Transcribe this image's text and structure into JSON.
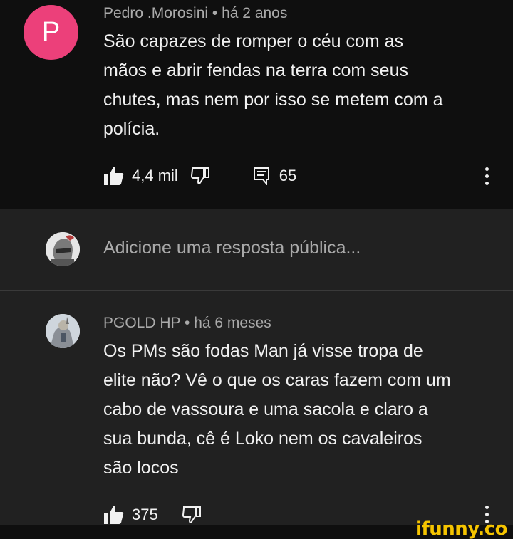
{
  "top_comment": {
    "avatar_letter": "P",
    "avatar_color": "#ec407a",
    "author": "Pedro .Morosini",
    "time": "há 2 anos",
    "lines": [
      "São capazes de romper o céu com as",
      "mãos e abrir fendas na terra com seus",
      "chutes, mas nem por isso se metem com a",
      "polícia."
    ],
    "likes": "4,4 mil",
    "replies": "65"
  },
  "reply_input": {
    "placeholder": "Adicione uma resposta pública..."
  },
  "reply_comment": {
    "author": "PGOLD HP",
    "time": "há 6 meses",
    "lines": [
      "Os PMs são fodas Man já visse tropa de",
      "elite não? Vê o que os caras fazem com um",
      "cabo de vassoura e uma sacola e claro a",
      "sua bunda, cê é Loko nem os cavaleiros",
      "são locos"
    ],
    "likes": "375"
  },
  "meta_separator": "•",
  "watermark": "ifunny.co",
  "icons": {
    "like": "thumbs-up-icon",
    "dislike": "thumbs-down-icon",
    "reply": "comment-icon",
    "more": "more-vertical-icon"
  }
}
